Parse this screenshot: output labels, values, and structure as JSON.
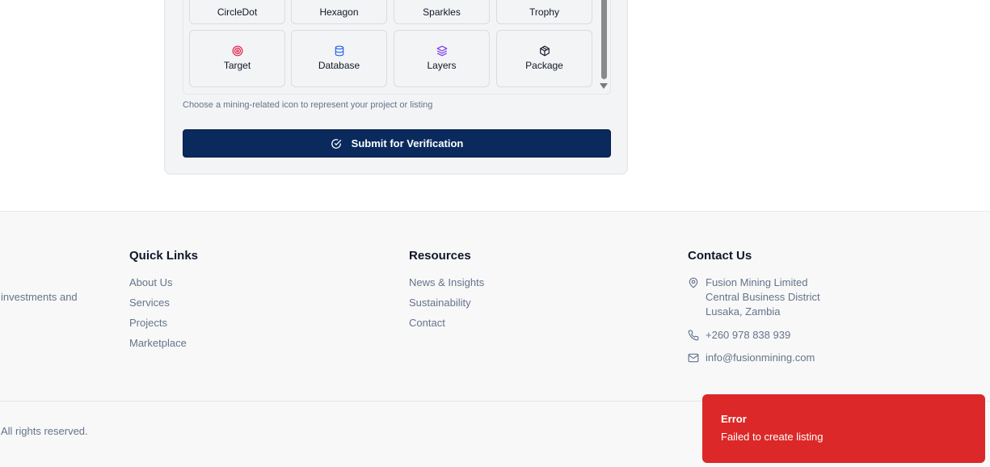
{
  "icon_picker": {
    "tiles_row1": [
      {
        "label": "CircleDot",
        "icon": "circle-dot-icon"
      },
      {
        "label": "Hexagon",
        "icon": "hexagon-icon"
      },
      {
        "label": "Sparkles",
        "icon": "sparkles-icon"
      },
      {
        "label": "Trophy",
        "icon": "trophy-icon"
      }
    ],
    "tiles_row2": [
      {
        "label": "Target",
        "icon": "target-icon",
        "color": "#e11d48"
      },
      {
        "label": "Database",
        "icon": "database-icon",
        "color": "#2563eb"
      },
      {
        "label": "Layers",
        "icon": "layers-icon",
        "color": "#7c3aed"
      },
      {
        "label": "Package",
        "icon": "package-icon",
        "color": "#111827"
      }
    ],
    "hint": "Choose a mining-related icon to represent your project or listing"
  },
  "submit": {
    "label": "Submit for Verification",
    "icon": "check-circle-icon",
    "color": "#0a2a5e"
  },
  "footer": {
    "about_fragment": "investments and",
    "quick_links": {
      "title": "Quick Links",
      "items": [
        "About Us",
        "Services",
        "Projects",
        "Marketplace"
      ]
    },
    "resources": {
      "title": "Resources",
      "items": [
        "News & Insights",
        "Sustainability",
        "Contact"
      ]
    },
    "contact": {
      "title": "Contact Us",
      "address": [
        "Fusion Mining Limited",
        "Central Business District",
        "Lusaka, Zambia"
      ],
      "phone": "+260 978 838 939",
      "email": "info@fusionmining.com"
    },
    "copyright_fragment": "All rights reserved."
  },
  "toast": {
    "title": "Error",
    "message": "Failed to create listing",
    "color": "#dc2828"
  }
}
